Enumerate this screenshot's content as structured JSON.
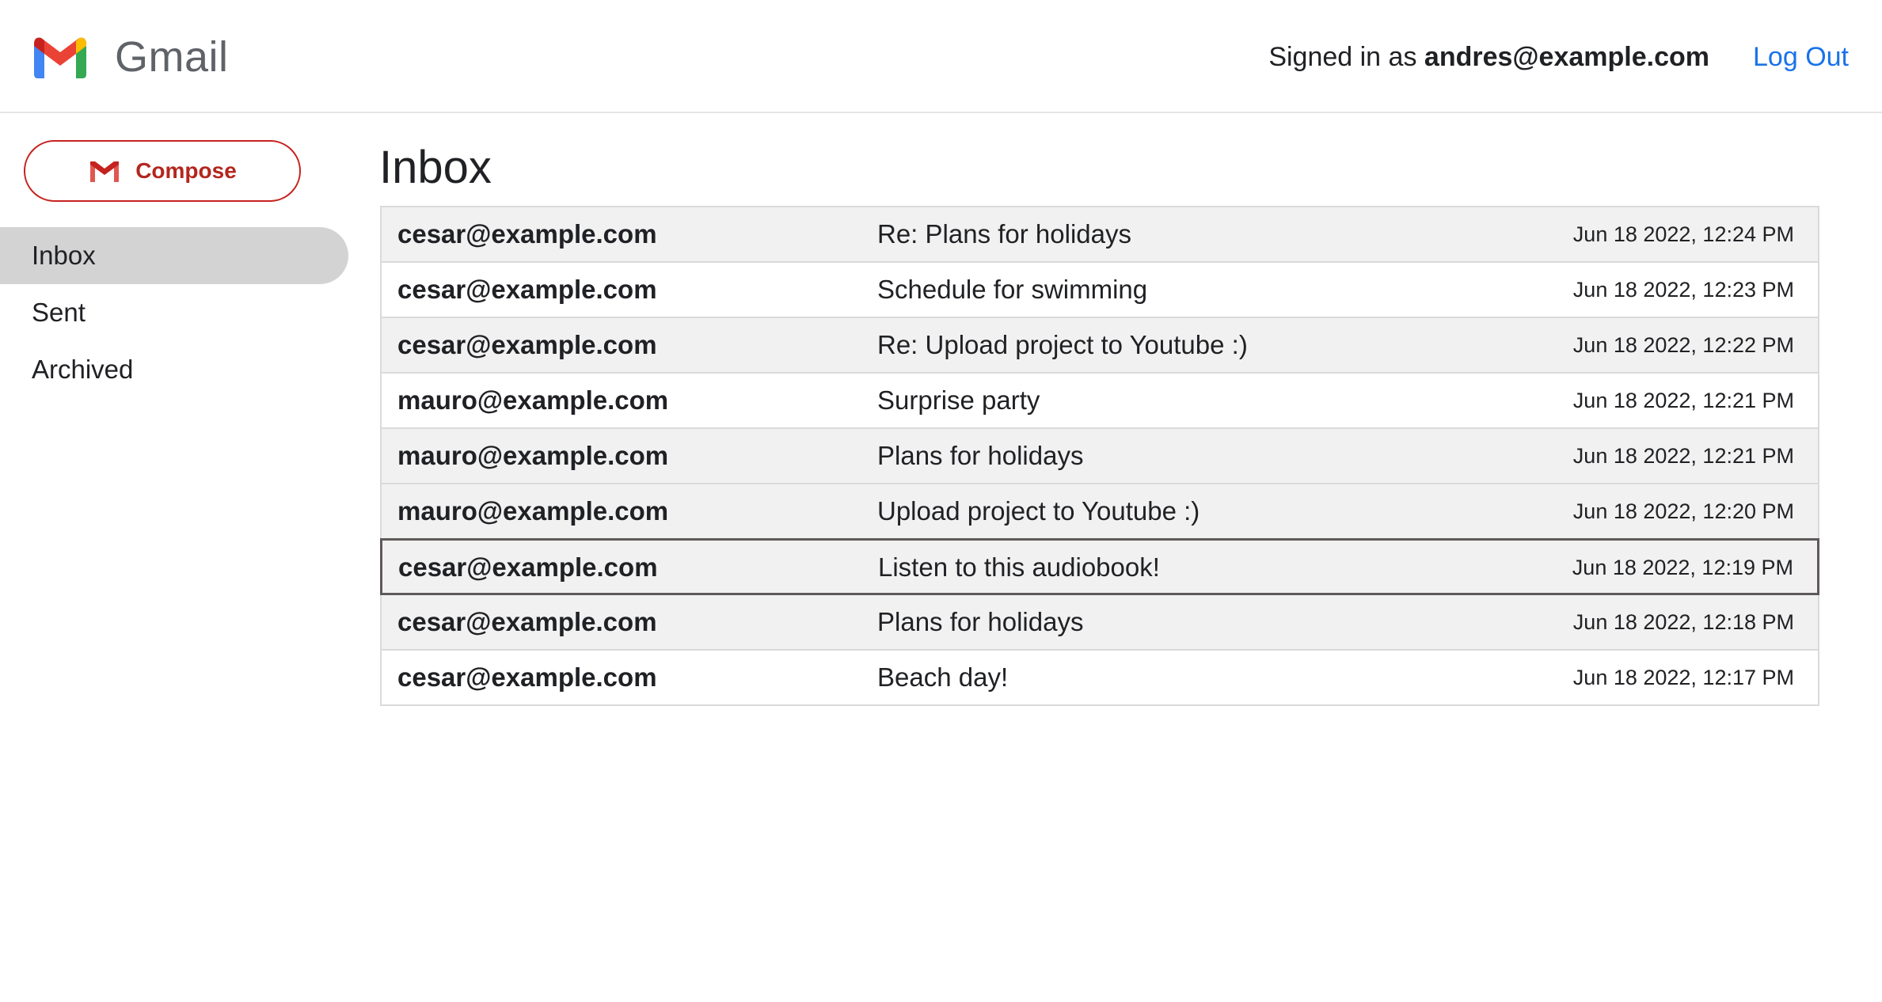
{
  "header": {
    "brand": "Gmail",
    "logo_icon": "gmail-logo-icon",
    "signed_in_prefix": "Signed in as ",
    "signed_in_user": "andres@example.com",
    "logout_label": "Log Out",
    "logout_color": "#1a73e8"
  },
  "sidebar": {
    "compose_label": "Compose",
    "compose_icon": "gmail-m-icon",
    "compose_color": "#c5221f",
    "items": [
      {
        "label": "Inbox",
        "active": true
      },
      {
        "label": "Sent",
        "active": false
      },
      {
        "label": "Archived",
        "active": false
      }
    ]
  },
  "main": {
    "title": "Inbox",
    "emails": [
      {
        "sender": "cesar@example.com",
        "subject": "Re: Plans for holidays",
        "timestamp": "Jun 18 2022, 12:24 PM",
        "read": true
      },
      {
        "sender": "cesar@example.com",
        "subject": "Schedule for swimming",
        "timestamp": "Jun 18 2022, 12:23 PM",
        "read": false
      },
      {
        "sender": "cesar@example.com",
        "subject": "Re: Upload project to Youtube :)",
        "timestamp": "Jun 18 2022, 12:22 PM",
        "read": true
      },
      {
        "sender": "mauro@example.com",
        "subject": "Surprise party",
        "timestamp": "Jun 18 2022, 12:21 PM",
        "read": false
      },
      {
        "sender": "mauro@example.com",
        "subject": "Plans for holidays",
        "timestamp": "Jun 18 2022, 12:21 PM",
        "read": true
      },
      {
        "sender": "mauro@example.com",
        "subject": "Upload project to Youtube :)",
        "timestamp": "Jun 18 2022, 12:20 PM",
        "read": true
      },
      {
        "sender": "cesar@example.com",
        "subject": "Listen to this audiobook!",
        "timestamp": "Jun 18 2022, 12:19 PM",
        "read": true,
        "focused": true
      },
      {
        "sender": "cesar@example.com",
        "subject": "Plans for holidays",
        "timestamp": "Jun 18 2022, 12:18 PM",
        "read": true
      },
      {
        "sender": "cesar@example.com",
        "subject": "Beach day!",
        "timestamp": "Jun 18 2022, 12:17 PM",
        "read": false
      }
    ]
  }
}
